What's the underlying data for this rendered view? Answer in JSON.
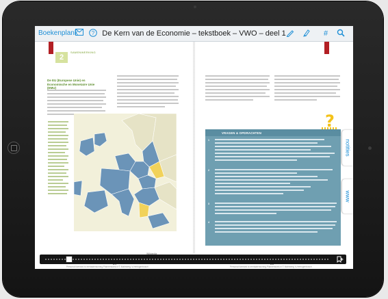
{
  "topbar": {
    "home_label": "Boekenplank",
    "title": "De Kern van de Economie – tekstboek – VWO – deel 1",
    "icons": [
      "mail-icon",
      "help-icon",
      "pencil-icon",
      "highlighter-icon",
      "hash-icon",
      "search-icon"
    ]
  },
  "left_page": {
    "chapter_number": "2",
    "chapter_label": "SAMENWERKING",
    "heading": "De EU (Europese Unie) en Economische en Monetaire Unie (EMU)",
    "page_number": "24",
    "footer": "Personal licensed to leerlaatenkoning.Plannenkoek.nl © Malmberg 's-Hertogenbosch",
    "map_caption": "Wikipedia"
  },
  "right_page": {
    "page_number": "25",
    "footer": "Personal licensed to leerlaatenkoning.Plannenkoek.nl © Malmberg 's-Hertogenbosch",
    "exercise_title": "VRAGEN & OPDRACHTEN",
    "questions": [
      "1",
      "2",
      "3",
      "4"
    ]
  },
  "side_tabs": {
    "notes": "notities",
    "web": "www"
  },
  "colors": {
    "accent": "#1e8fd6",
    "exercise_bg": "#6f9fb1",
    "map_member": "#6b94b8",
    "map_highlight": "#f1d25a",
    "ribbon": "#b21f24"
  }
}
